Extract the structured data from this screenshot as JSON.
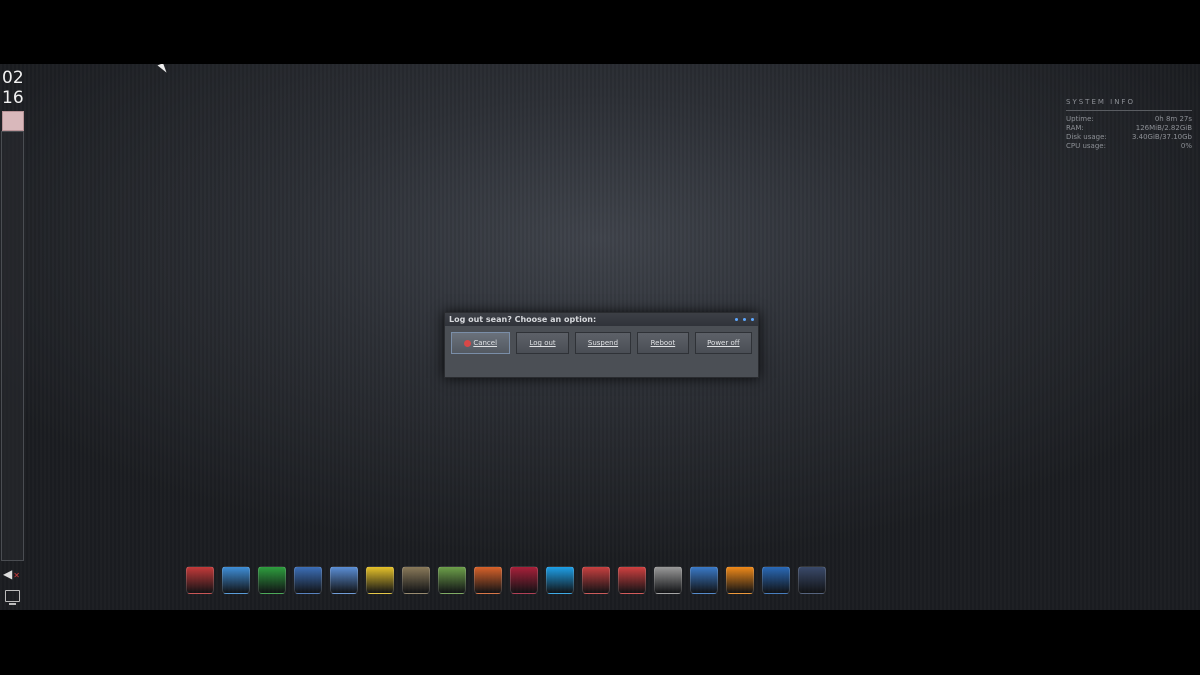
{
  "clock": {
    "hours": "02",
    "minutes": "16"
  },
  "system_info": {
    "title": "SYSTEM INFO",
    "rows": [
      {
        "label": "Uptime:",
        "value": "0h 8m 27s"
      },
      {
        "label": "RAM:",
        "value": "126MiB/2.82GiB"
      },
      {
        "label": "Disk usage:",
        "value": "3.40GiB/37.10Gb"
      },
      {
        "label": "CPU usage:",
        "value": "0%"
      }
    ]
  },
  "dialog": {
    "title": "Log out sean? Choose an option:",
    "buttons": {
      "cancel": "Cancel",
      "logout": "Log out",
      "suspend": "Suspend",
      "reboot": "Reboot",
      "poweroff": "Power off"
    }
  },
  "dock": {
    "items": [
      {
        "name": "red-terminal-icon",
        "color": "#c43a3a"
      },
      {
        "name": "bluetooth-swan-icon",
        "color": "#3f8fd8"
      },
      {
        "name": "spreadsheet-icon",
        "color": "#2e9e3e"
      },
      {
        "name": "calculator-icon",
        "color": "#3c6fb8"
      },
      {
        "name": "chromium-icon",
        "color": "#5b8fd6"
      },
      {
        "name": "teapot-icon",
        "color": "#e6c22a"
      },
      {
        "name": "gimp-icon",
        "color": "#8a7a5a"
      },
      {
        "name": "drive-icon",
        "color": "#6da04a"
      },
      {
        "name": "impress-icon",
        "color": "#d8622a"
      },
      {
        "name": "debian-swirl-icon",
        "color": "#a8203a"
      },
      {
        "name": "skype-icon",
        "color": "#1ea0e8"
      },
      {
        "name": "package-icon",
        "color": "#c84040"
      },
      {
        "name": "installer-icon",
        "color": "#d04040"
      },
      {
        "name": "usb-tool-icon",
        "color": "#9a9a9a"
      },
      {
        "name": "system-monitor-icon",
        "color": "#3a7ac8"
      },
      {
        "name": "vlc-icon",
        "color": "#f08a1a"
      },
      {
        "name": "writer-icon",
        "color": "#2a6ab8"
      },
      {
        "name": "xbmc-icon",
        "color": "#3a4a6a"
      }
    ]
  }
}
